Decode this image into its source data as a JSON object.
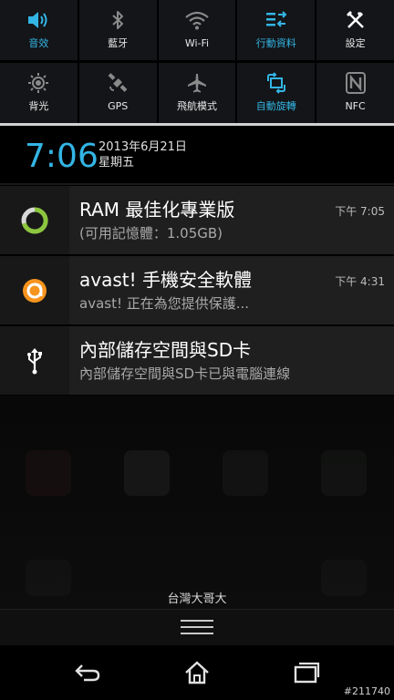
{
  "quick_settings": {
    "row1": [
      {
        "label": "音效",
        "icon": "volume-icon",
        "active": true
      },
      {
        "label": "藍牙",
        "icon": "bluetooth-icon",
        "active": false
      },
      {
        "label": "Wi-Fi",
        "icon": "wifi-icon",
        "active": false
      },
      {
        "label": "行動資料",
        "icon": "mobile-data-icon",
        "active": true
      },
      {
        "label": "設定",
        "icon": "settings-tools-icon",
        "active": false
      }
    ],
    "row2": [
      {
        "label": "背光",
        "icon": "brightness-icon",
        "active": false
      },
      {
        "label": "GPS",
        "icon": "gps-satellite-icon",
        "active": false
      },
      {
        "label": "飛航模式",
        "icon": "airplane-icon",
        "active": false
      },
      {
        "label": "自動旋轉",
        "icon": "rotate-icon",
        "active": true
      },
      {
        "label": "NFC",
        "icon": "nfc-icon",
        "active": false
      }
    ]
  },
  "header": {
    "time": "7:06",
    "date": "2013年6月21日",
    "weekday": "星期五"
  },
  "notifications": [
    {
      "title": "RAM 最佳化專業版",
      "text": "(可用記憶體：1.05GB)",
      "time": "下午 7:05",
      "icon": "ram-optimizer-icon"
    },
    {
      "title": "avast! 手機安全軟體",
      "text": "avast! 正在為您提供保護...",
      "time": "下午 4:31",
      "icon": "avast-icon"
    },
    {
      "title": "內部儲存空間與SD卡",
      "text": "內部儲存空間與SD卡已與電腦連線",
      "time": "",
      "icon": "usb-icon"
    }
  ],
  "carrier": "台灣大哥大",
  "navigation": {
    "back": "back-icon",
    "home": "home-icon",
    "recents": "recents-icon"
  },
  "watermark": "#211740",
  "colors": {
    "accent": "#33b5e5",
    "panel": "#1f1f20",
    "background": "#000000"
  }
}
